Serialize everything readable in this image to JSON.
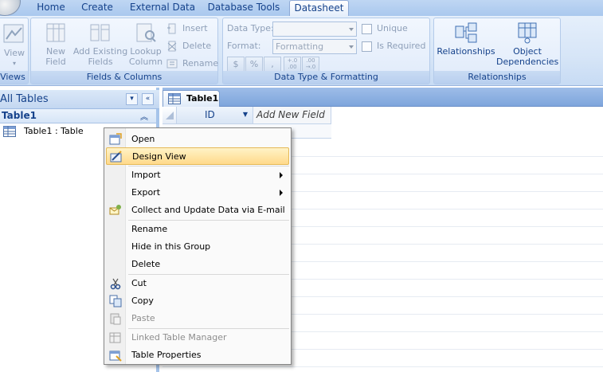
{
  "ribbon_tabs": [
    {
      "label": "Home"
    },
    {
      "label": "Create"
    },
    {
      "label": "External Data"
    },
    {
      "label": "Database Tools"
    },
    {
      "label": "Datasheet",
      "active": true
    }
  ],
  "ribbon": {
    "views": {
      "view_label": "View",
      "group_label": "Views"
    },
    "fields_columns": {
      "new_field": "New\nField",
      "add_existing_fields": "Add Existing\nFields",
      "lookup_column": "Lookup\nColumn",
      "insert": "Insert",
      "delete": "Delete",
      "rename": "Rename",
      "group_label": "Fields & Columns"
    },
    "data_type_formatting": {
      "data_type_label": "Data Type:",
      "format_label": "Format:",
      "format_value": "Formatting",
      "unique": "Unique",
      "is_required": "Is Required",
      "currency": "$",
      "percent": "%",
      "comma": ",",
      "increase_decimals": "+.0\n.00",
      "decrease_decimals": ".00\n→.0",
      "group_label": "Data Type & Formatting"
    },
    "relationships": {
      "relationships": "Relationships",
      "object_dependencies": "Object\nDependencies",
      "group_label": "Relationships"
    }
  },
  "nav_pane": {
    "title": "All Tables",
    "group_title": "Table1",
    "item_label": "Table1 : Table"
  },
  "document": {
    "tab_label": "Table1",
    "columns": [
      "ID",
      "Add New Field"
    ]
  },
  "context_menu": {
    "items": [
      {
        "label": "Open",
        "icon": "open-table-icon"
      },
      {
        "label": "Design View",
        "icon": "design-view-icon",
        "highlighted": true
      },
      {
        "label": "Import",
        "submenu": true
      },
      {
        "label": "Export",
        "submenu": true
      },
      {
        "label": "Collect and Update Data via E-mail",
        "icon": "email-collect-icon"
      },
      {
        "label": "Rename"
      },
      {
        "label": "Hide in this Group"
      },
      {
        "label": "Delete"
      },
      {
        "label": "Cut",
        "icon": "scissors-icon"
      },
      {
        "label": "Copy",
        "icon": "copy-icon"
      },
      {
        "label": "Paste",
        "icon": "paste-icon",
        "disabled": true
      },
      {
        "label": "Linked Table Manager",
        "icon": "linked-table-icon",
        "disabled": true
      },
      {
        "label": "Table Properties",
        "icon": "table-properties-icon"
      }
    ]
  },
  "colors": {
    "ribbon_text": "#15428b",
    "highlight": "#ffd98a",
    "disabled_text": "#8d8d8d"
  }
}
